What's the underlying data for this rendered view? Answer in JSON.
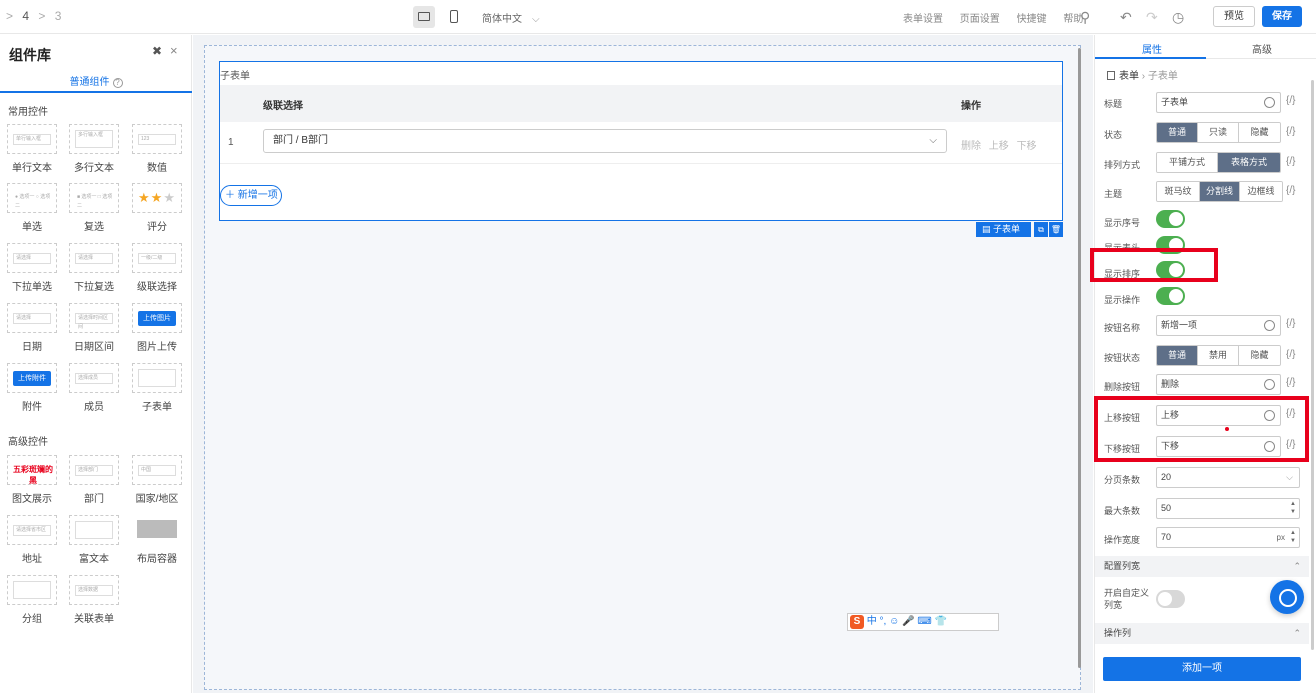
{
  "topbar": {
    "breadcrumb": [
      ">",
      "4",
      ">",
      "3"
    ],
    "language": "简体中文",
    "links": [
      "表单设置",
      "页面设置",
      "快捷键",
      "帮助"
    ],
    "preview_label": "预览",
    "save_label": "保存"
  },
  "library": {
    "title": "组件库",
    "tab_label": "普通组件",
    "common_title": "常用控件",
    "advanced_title": "高级控件",
    "common": [
      {
        "label": "单行文本",
        "thumb": "单行输入框"
      },
      {
        "label": "多行文本",
        "thumb": "多行输入框"
      },
      {
        "label": "数值",
        "thumb": "123"
      },
      {
        "label": "单选",
        "thumb": "● 选项一  ○ 选项二"
      },
      {
        "label": "复选",
        "thumb": "■ 选项一  □ 选项二"
      },
      {
        "label": "评分",
        "thumb": ""
      },
      {
        "label": "下拉单选",
        "thumb": "请选择"
      },
      {
        "label": "下拉复选",
        "thumb": "请选择"
      },
      {
        "label": "级联选择",
        "thumb": "一级/二级"
      },
      {
        "label": "日期",
        "thumb": "请选择"
      },
      {
        "label": "日期区间",
        "thumb": "请选择时间区间"
      },
      {
        "label": "图片上传",
        "thumb": "上传图片"
      },
      {
        "label": "附件",
        "thumb": "上传附件"
      },
      {
        "label": "成员",
        "thumb": "选择成员"
      },
      {
        "label": "子表单",
        "thumb": ""
      }
    ],
    "advanced": [
      {
        "label": "图文展示",
        "thumb": "五彩斑斓的黑"
      },
      {
        "label": "部门",
        "thumb": "选择部门"
      },
      {
        "label": "国家/地区",
        "thumb": "中国"
      },
      {
        "label": "地址",
        "thumb": "请选择省市区"
      },
      {
        "label": "富文本",
        "thumb": ""
      },
      {
        "label": "布局容器",
        "thumb": ""
      },
      {
        "label": "分组",
        "thumb": ""
      },
      {
        "label": "关联表单",
        "thumb": "选择数据"
      }
    ]
  },
  "canvas": {
    "subform_title": "子表单",
    "columns": [
      "级联选择",
      "操作"
    ],
    "rows": [
      {
        "index": "1",
        "value": "部门 / B部门",
        "ops": [
          "删除",
          "上移",
          "下移"
        ]
      }
    ],
    "add_label": "新增一项",
    "tag_label": "子表单"
  },
  "ime_bar": "中 °, ☺ 🎤 ⌨ 👕",
  "props": {
    "tabs": [
      "属性",
      "高级"
    ],
    "breadcrumb": [
      "表单",
      "子表单"
    ],
    "expr": "{/}",
    "title_label": "标题",
    "title_value": "子表单",
    "state_label": "状态",
    "state_options": [
      "普通",
      "只读",
      "隐藏"
    ],
    "layout_label": "排列方式",
    "layout_options": [
      "平铺方式",
      "表格方式"
    ],
    "theme_label": "主题",
    "theme_options": [
      "斑马纹",
      "分割线",
      "边框线"
    ],
    "show_index_label": "显示序号",
    "show_header_label": "显示表头",
    "show_sort_label": "显示排序",
    "show_ops_label": "显示操作",
    "btn_name_label": "按钮名称",
    "btn_name_value": "新增一项",
    "btn_state_label": "按钮状态",
    "btn_state_options": [
      "普通",
      "禁用",
      "隐藏"
    ],
    "delete_btn_label": "删除按钮",
    "delete_btn_value": "删除",
    "up_btn_label": "上移按钮",
    "up_btn_value": "上移",
    "down_btn_label": "下移按钮",
    "down_btn_value": "下移",
    "page_size_label": "分页条数",
    "page_size_value": "20",
    "max_label": "最大条数",
    "max_value": "50",
    "op_width_label": "操作宽度",
    "op_width_value": "70",
    "op_width_unit": "px",
    "config_cols_label": "配置列宽",
    "custom_width_label": "开启自定义列宽",
    "op_col_label": "操作列",
    "add_item_label": "添加一项"
  }
}
